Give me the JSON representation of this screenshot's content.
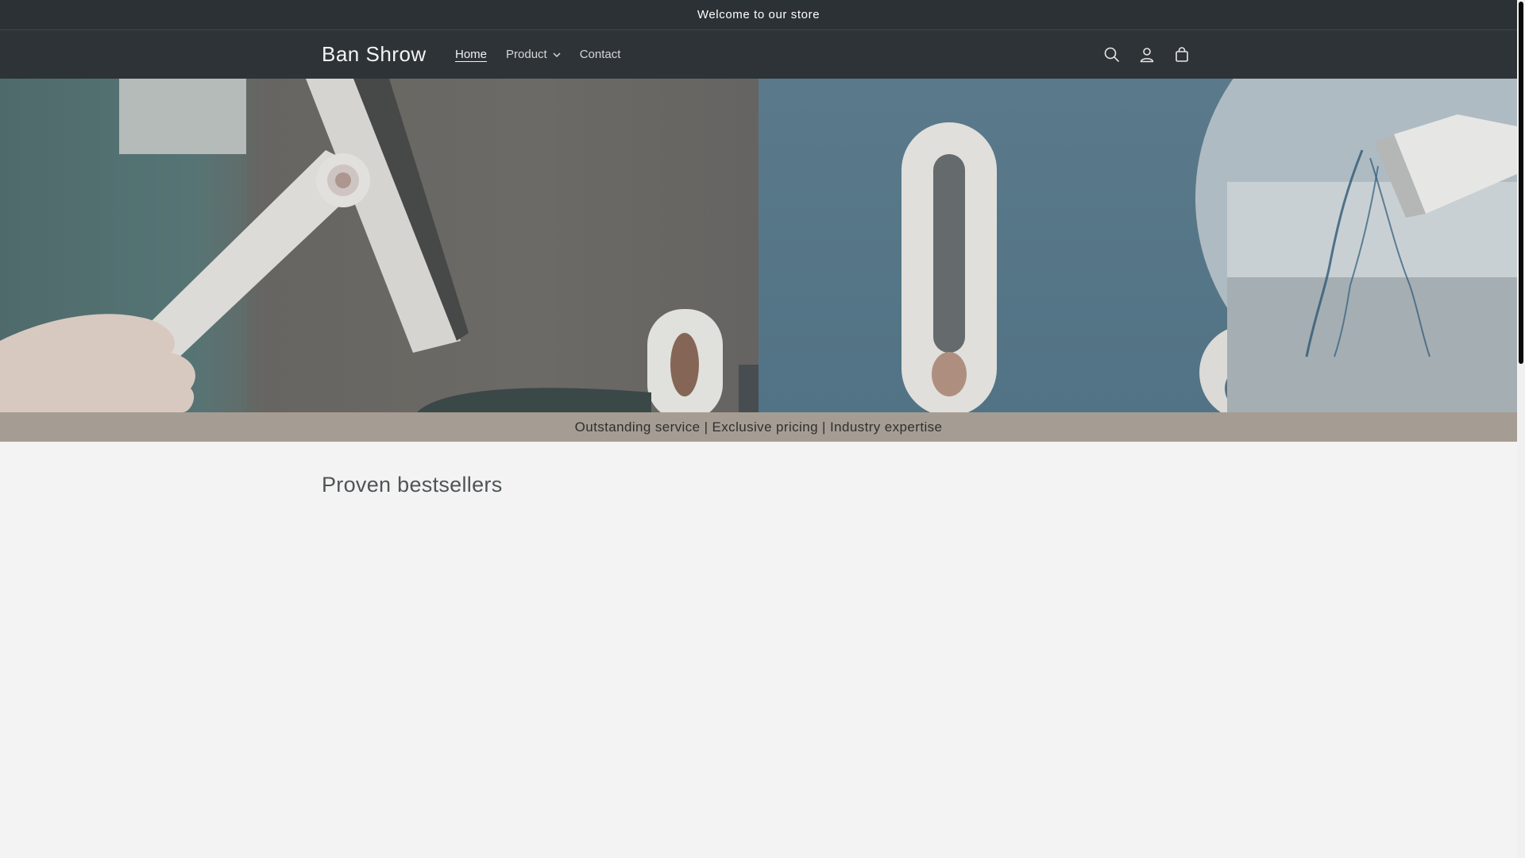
{
  "announcement": {
    "text": "Welcome to our store"
  },
  "header": {
    "logo": "Ban Shrow",
    "nav": [
      {
        "label": "Home",
        "active": true
      },
      {
        "label": "Product",
        "has_dropdown": true
      },
      {
        "label": "Contact"
      }
    ],
    "icons": [
      "search-icon",
      "account-icon",
      "cart-icon"
    ]
  },
  "hero": {
    "images": [
      "mop-hand-image",
      "mop-water-image"
    ]
  },
  "strip": {
    "text": "Outstanding service | Exclusive pricing | Industry expertise"
  },
  "main": {
    "section_title": "Proven bestsellers"
  },
  "colors": {
    "announcement_bg": "#2c3136",
    "header_bg": "#2e3338",
    "strip_bg": "#a59d93",
    "page_bg": "#f3f3f3"
  }
}
